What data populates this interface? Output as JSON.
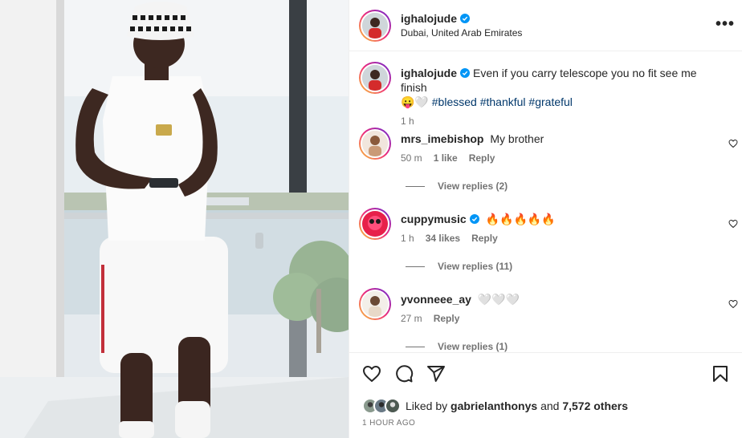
{
  "post": {
    "username": "ighalojude",
    "location": "Dubai, United Arab Emirates",
    "more_label": "•••"
  },
  "caption": {
    "username": "ighalojude",
    "text": "Even if you carry telescope you no fit see me finish",
    "emoji": "😛🤍",
    "hashtags": [
      "#blessed",
      "#thankful",
      "#grateful"
    ],
    "time": "1 h"
  },
  "comments": [
    {
      "username": "mrs_imebishop",
      "text": "My brother",
      "time": "50 m",
      "likes": "1 like",
      "reply": "Reply",
      "view_replies": "View replies (2)",
      "verified": false
    },
    {
      "username": "cuppymusic",
      "text": "🔥🔥🔥🔥🔥",
      "time": "1 h",
      "likes": "34 likes",
      "reply": "Reply",
      "view_replies": "View replies (11)",
      "verified": true
    },
    {
      "username": "yvonneee_ay",
      "text": "🤍🤍🤍",
      "time": "27 m",
      "likes": "",
      "reply": "Reply",
      "view_replies": "View replies (1)",
      "verified": false
    }
  ],
  "likes": {
    "prefix": "Liked by",
    "user": "gabrielanthonys",
    "middle": "and",
    "count": "7,572 others"
  },
  "time_ago": "1 HOUR AGO",
  "colors": {
    "verified": "#0095f6",
    "hashtag": "#00376b",
    "muted": "#737373",
    "ring_gradient": [
      "#f9ce34",
      "#ee2a7b",
      "#6228d7"
    ]
  }
}
